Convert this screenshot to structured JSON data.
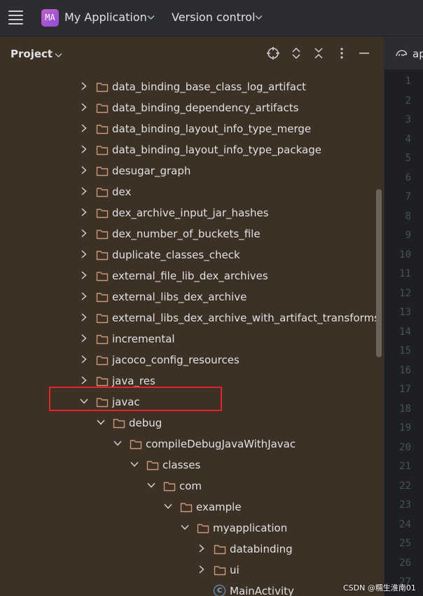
{
  "topbar": {
    "project_badge": "MA",
    "project_name": "My Application",
    "version_control": "Version control"
  },
  "panel": {
    "title": "Project",
    "icons": [
      "locate-icon",
      "expand-all-icon",
      "collapse-all-icon",
      "more-options-icon",
      "hide-icon"
    ]
  },
  "tree": [
    {
      "label": "data_binding_base_class_log_artifact",
      "kind": "folder",
      "expanded": false,
      "depth": 0
    },
    {
      "label": "data_binding_dependency_artifacts",
      "kind": "folder",
      "expanded": false,
      "depth": 0
    },
    {
      "label": "data_binding_layout_info_type_merge",
      "kind": "folder",
      "expanded": false,
      "depth": 0
    },
    {
      "label": "data_binding_layout_info_type_package",
      "kind": "folder",
      "expanded": false,
      "depth": 0
    },
    {
      "label": "desugar_graph",
      "kind": "folder",
      "expanded": false,
      "depth": 0
    },
    {
      "label": "dex",
      "kind": "folder",
      "expanded": false,
      "depth": 0
    },
    {
      "label": "dex_archive_input_jar_hashes",
      "kind": "folder",
      "expanded": false,
      "depth": 0
    },
    {
      "label": "dex_number_of_buckets_file",
      "kind": "folder",
      "expanded": false,
      "depth": 0
    },
    {
      "label": "duplicate_classes_check",
      "kind": "folder",
      "expanded": false,
      "depth": 0
    },
    {
      "label": "external_file_lib_dex_archives",
      "kind": "folder",
      "expanded": false,
      "depth": 0
    },
    {
      "label": "external_libs_dex_archive",
      "kind": "folder",
      "expanded": false,
      "depth": 0
    },
    {
      "label": "external_libs_dex_archive_with_artifact_transforms",
      "kind": "folder",
      "expanded": false,
      "depth": 0
    },
    {
      "label": "incremental",
      "kind": "folder",
      "expanded": false,
      "depth": 0
    },
    {
      "label": "jacoco_config_resources",
      "kind": "folder",
      "expanded": false,
      "depth": 0
    },
    {
      "label": "java_res",
      "kind": "folder",
      "expanded": false,
      "depth": 0
    },
    {
      "label": "javac",
      "kind": "folder",
      "expanded": true,
      "depth": 0,
      "highlighted": true
    },
    {
      "label": "debug",
      "kind": "folder",
      "expanded": true,
      "depth": 1
    },
    {
      "label": "compileDebugJavaWithJavac",
      "kind": "folder",
      "expanded": true,
      "depth": 2
    },
    {
      "label": "classes",
      "kind": "folder",
      "expanded": true,
      "depth": 3
    },
    {
      "label": "com",
      "kind": "folder",
      "expanded": true,
      "depth": 4
    },
    {
      "label": "example",
      "kind": "folder",
      "expanded": true,
      "depth": 5
    },
    {
      "label": "myapplication",
      "kind": "folder",
      "expanded": true,
      "depth": 6
    },
    {
      "label": "databinding",
      "kind": "folder",
      "expanded": false,
      "depth": 7
    },
    {
      "label": "ui",
      "kind": "folder",
      "expanded": false,
      "depth": 7
    },
    {
      "label": "MainActivity",
      "kind": "class",
      "depth": 7
    }
  ],
  "editor": {
    "tab_label": "ap",
    "line_numbers": [
      "1",
      "2",
      "3",
      "4",
      "5",
      "6",
      "7",
      "8",
      "9",
      "10",
      "11",
      "12",
      "13",
      "14",
      "15",
      "16",
      "17",
      "18",
      "19",
      "20",
      "21",
      "22",
      "23",
      "24",
      "25",
      "26",
      "27"
    ]
  },
  "watermark": "CSDN @糯生淮南01",
  "colors": {
    "panel_bg": "#3d3024",
    "topbar_bg": "#2b2d30",
    "editor_bg": "#1e1f22",
    "highlight_border": "#e0242a",
    "folder_stroke": "#c99a7a",
    "class_icon": "#6fa8dc"
  }
}
